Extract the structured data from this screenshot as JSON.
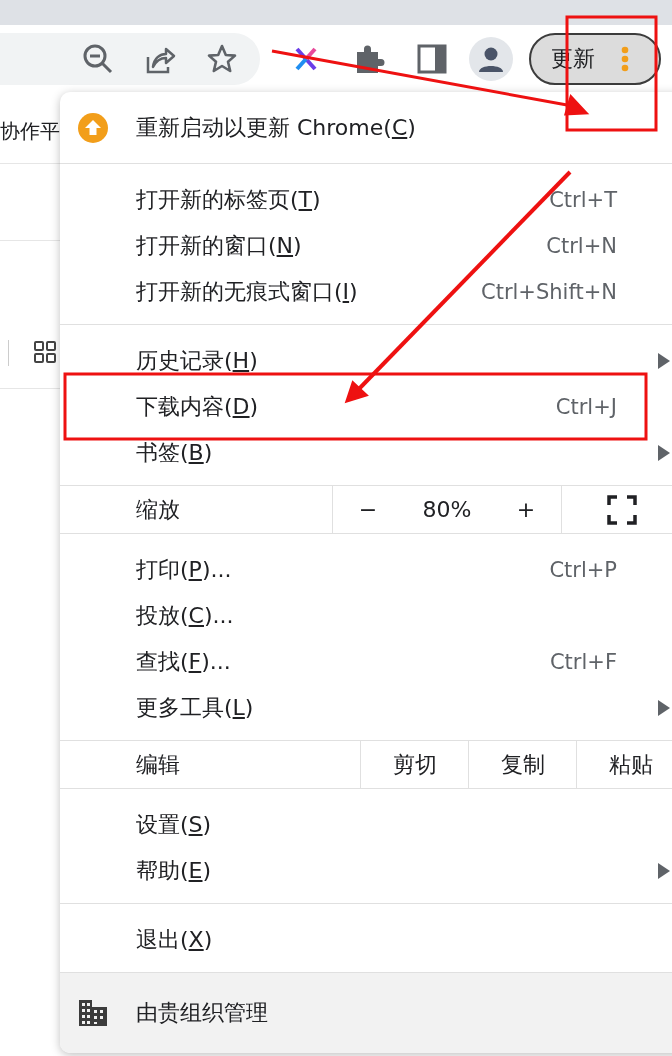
{
  "toolbar": {
    "update_button": "更新"
  },
  "bookmarks_bar": {
    "items": [
      "协作平"
    ]
  },
  "menu": {
    "sections": [
      {
        "items": [
          {
            "kind": "update",
            "label": "重新启动以更新 Chrome(C)"
          }
        ]
      },
      {
        "items": [
          {
            "kind": "item",
            "label": "打开新的标签页(T)",
            "shortcut": "Ctrl+T",
            "submenu": false
          },
          {
            "kind": "item",
            "label": "打开新的窗口(N)",
            "shortcut": "Ctrl+N",
            "submenu": false
          },
          {
            "kind": "item",
            "label": "打开新的无痕式窗口(I)",
            "shortcut": "Ctrl+Shift+N",
            "submenu": false
          }
        ]
      },
      {
        "items": [
          {
            "kind": "item",
            "label": "历史记录(H)",
            "submenu": true
          },
          {
            "kind": "item",
            "label": "下载内容(D)",
            "shortcut": "Ctrl+J",
            "submenu": false
          },
          {
            "kind": "item",
            "label": "书签(B)",
            "submenu": true
          }
        ]
      },
      {
        "items": [
          {
            "kind": "zoom",
            "label": "缩放",
            "minus": "−",
            "value": "80%",
            "plus": "+"
          }
        ]
      },
      {
        "items": [
          {
            "kind": "item",
            "label": "打印(P)...",
            "shortcut": "Ctrl+P",
            "submenu": false
          },
          {
            "kind": "item",
            "label": "投放(C)...",
            "submenu": false
          },
          {
            "kind": "item",
            "label": "查找(F)...",
            "shortcut": "Ctrl+F",
            "submenu": false
          },
          {
            "kind": "item",
            "label": "更多工具(L)",
            "submenu": true
          }
        ]
      },
      {
        "items": [
          {
            "kind": "edit",
            "label": "编辑",
            "buttons": [
              "剪切",
              "复制",
              "粘贴"
            ]
          }
        ]
      },
      {
        "items": [
          {
            "kind": "item",
            "label": "设置(S)",
            "submenu": false
          },
          {
            "kind": "item",
            "label": "帮助(E)",
            "submenu": true
          }
        ]
      },
      {
        "items": [
          {
            "kind": "item",
            "label": "退出(X)",
            "submenu": false
          }
        ]
      },
      {
        "items": [
          {
            "kind": "managed",
            "label": "由贵组织管理"
          }
        ]
      }
    ]
  }
}
